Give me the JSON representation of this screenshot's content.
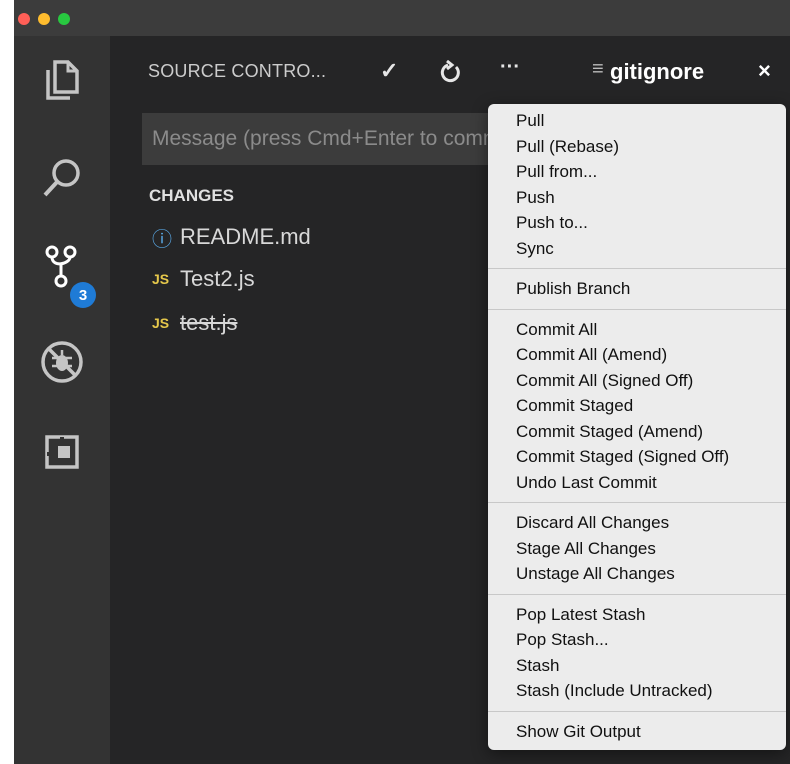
{
  "sidebar": {
    "title": "SOURCE CONTRO...",
    "commit_placeholder": "Message (press Cmd+Enter to commit)",
    "changes_label": "CHANGES",
    "files": [
      {
        "icon": "info-icon",
        "prefix": "ⓘ",
        "name": "README.md",
        "deleted": false
      },
      {
        "icon": "js-icon",
        "prefix": "JS",
        "name": "Test2.js",
        "deleted": false
      },
      {
        "icon": "js-icon",
        "prefix": "JS",
        "name": "test.js",
        "deleted": true
      }
    ]
  },
  "activitybar": {
    "scm_badge": "3"
  },
  "editor": {
    "tab_title": "gitignore"
  },
  "menu": {
    "groups": [
      [
        "Pull",
        "Pull (Rebase)",
        "Pull from...",
        "Push",
        "Push to...",
        "Sync"
      ],
      [
        "Publish Branch"
      ],
      [
        "Commit All",
        "Commit All (Amend)",
        "Commit All (Signed Off)",
        "Commit Staged",
        "Commit Staged (Amend)",
        "Commit Staged (Signed Off)",
        "Undo Last Commit"
      ],
      [
        "Discard All Changes",
        "Stage All Changes",
        "Unstage All Changes"
      ],
      [
        "Pop Latest Stash",
        "Pop Stash...",
        "Stash",
        "Stash (Include Untracked)"
      ],
      [
        "Show Git Output"
      ]
    ]
  },
  "colors": {
    "badge": "#1f7bd6",
    "activitybar": "#333333",
    "sidebar": "#252526",
    "menu": "#ececec"
  }
}
